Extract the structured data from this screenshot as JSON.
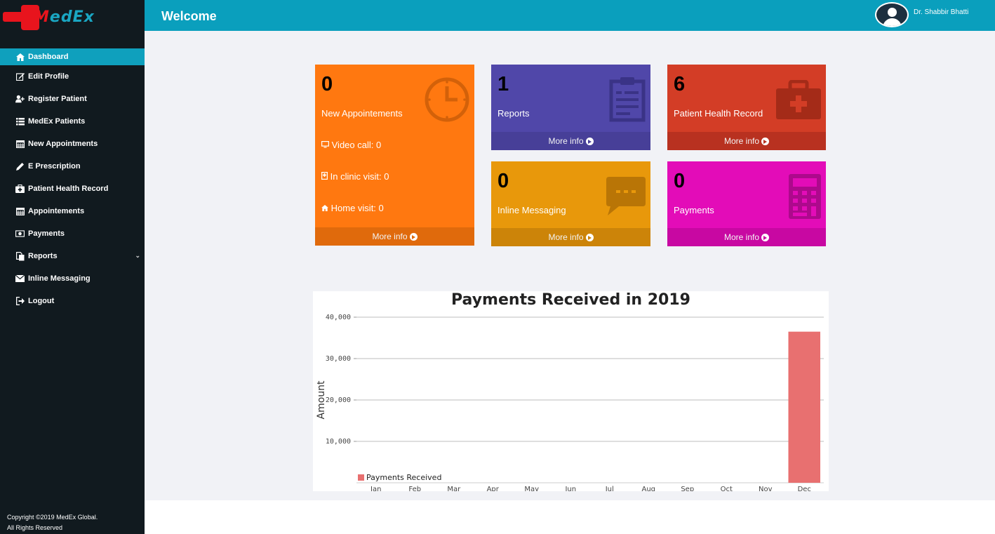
{
  "brand": {
    "name_first": "M",
    "name_rest": "edEx"
  },
  "sidebar": {
    "items": [
      {
        "label": "Dashboard",
        "icon": "home-icon",
        "active": true
      },
      {
        "label": "Edit Profile",
        "icon": "edit-icon"
      },
      {
        "label": "Register Patient",
        "icon": "user-plus-icon"
      },
      {
        "label": "MedEx Patients",
        "icon": "list-icon"
      },
      {
        "label": "New Appointments",
        "icon": "calendar-icon"
      },
      {
        "label": "E Prescription",
        "icon": "pencil-icon"
      },
      {
        "label": "Patient Health Record",
        "icon": "medkit-icon"
      },
      {
        "label": "Appointements",
        "icon": "calendar-icon"
      },
      {
        "label": "Payments",
        "icon": "money-icon"
      },
      {
        "label": "Reports",
        "icon": "files-icon",
        "has_submenu": true
      },
      {
        "label": "Inline Messaging",
        "icon": "envelope-icon"
      },
      {
        "label": "Logout",
        "icon": "sign-out-icon"
      }
    ],
    "copyright_line1": "Copyright ©2019 MedEx Global.",
    "copyright_line2": "All Rights Reserved"
  },
  "header": {
    "title": "Welcome",
    "username": "Dr. Shabbir Bhatti"
  },
  "boxes": {
    "appointments": {
      "count": "0",
      "label": "New Appointements",
      "video": "Video call: 0",
      "clinic": "In clinic visit: 0",
      "home": "Home visit: 0",
      "more": "More info",
      "color": "#ff7810",
      "footer_color": "#e06a0c"
    },
    "reports": {
      "count": "1",
      "label": "Reports",
      "more": "More info",
      "color": "#5047a9",
      "footer_color": "#473f98"
    },
    "health": {
      "count": "6",
      "label": "Patient Health Record",
      "more": "More info",
      "color": "#d33d26",
      "footer_color": "#b83120"
    },
    "messaging": {
      "count": "0",
      "label": "Inline Messaging",
      "more": "More info",
      "color": "#e8980b",
      "footer_color": "#cc8409"
    },
    "payments": {
      "count": "0",
      "label": "Payments",
      "more": "More info",
      "color": "#e30cb8",
      "footer_color": "#c808a2"
    }
  },
  "chart_data": {
    "type": "bar",
    "title": "Payments Received in 2019",
    "ylabel": "Amount",
    "xlabel": "",
    "categories": [
      "Jan",
      "Feb",
      "Mar",
      "Apr",
      "May",
      "Jun",
      "Jul",
      "Aug",
      "Sep",
      "Oct",
      "Nov",
      "Dec"
    ],
    "series": [
      {
        "name": "Payments Received",
        "values": [
          0,
          0,
          0,
          0,
          0,
          0,
          0,
          0,
          0,
          0,
          0,
          36500
        ],
        "color": "#e87070"
      }
    ],
    "ylim": [
      0,
      40000
    ],
    "yticks": [
      "10,000",
      "20,000",
      "30,000",
      "40,000"
    ],
    "ytick_values": [
      10000,
      20000,
      30000,
      40000
    ],
    "grid": true,
    "legend_position": "bottom-left"
  }
}
